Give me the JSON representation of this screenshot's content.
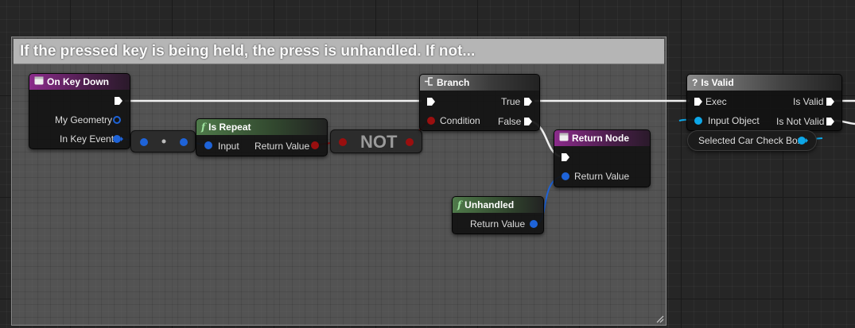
{
  "comment": {
    "title": "If the pressed key is being held, the press is unhandled. If not..."
  },
  "nodes": {
    "on_key_down": {
      "title": "On Key Down",
      "pins": [
        "My Geometry",
        "In Key Event"
      ]
    },
    "is_repeat": {
      "title": "Is Repeat",
      "pins": [
        "Input",
        "Return Value"
      ]
    },
    "not_node": {
      "title": "NOT"
    },
    "branch": {
      "title": "Branch",
      "pins": [
        "Condition",
        "True",
        "False"
      ]
    },
    "return_node": {
      "title": "Return Node",
      "pins": [
        "Return Value"
      ]
    },
    "unhandled": {
      "title": "Unhandled",
      "pins": [
        "Return Value"
      ]
    },
    "is_valid": {
      "title": "Is Valid",
      "pins": [
        "Exec",
        "Input Object",
        "Is Valid",
        "Is Not Valid"
      ]
    },
    "selected_var": {
      "title": "Selected Car Check Box"
    }
  },
  "colors": {
    "exec": "#ffffff",
    "struct": "#1e63d8",
    "bool": "#9a0f0f",
    "object": "#0da7e8",
    "event_header": "#8b2b8b",
    "function_header": "#4f7a4a"
  },
  "icons": {
    "event": "event-node-icon",
    "function": "function-icon",
    "branch": "branch-icon",
    "return": "return-node-icon",
    "valid": "question-icon"
  }
}
